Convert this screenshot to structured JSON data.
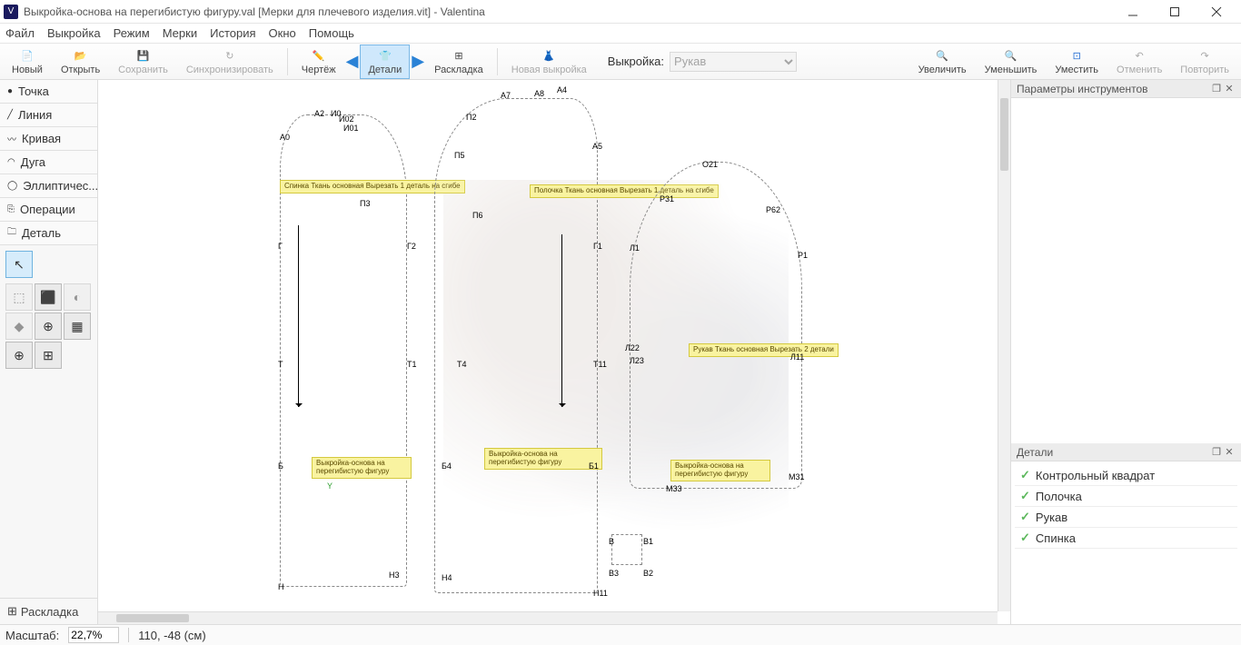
{
  "title": "Выкройка-основа на перегибистую фигуру.val [Мерки для плечевого изделия.vit] - Valentina",
  "menu": {
    "file": "Файл",
    "pattern": "Выкройка",
    "mode": "Режим",
    "measures": "Мерки",
    "history": "История",
    "window": "Окно",
    "help": "Помощь"
  },
  "toolbar": {
    "new": "Новый",
    "open": "Открыть",
    "save": "Сохранить",
    "sync": "Синхронизировать",
    "drawing": "Чертёж",
    "details": "Детали",
    "layout": "Раскладка",
    "newpattern": "Новая выкройка",
    "pattern_label": "Выкройка:",
    "pattern_value": "Рукав",
    "zoomin": "Увеличить",
    "zoomout": "Уменьшить",
    "fit": "Уместить",
    "undo": "Отменить",
    "redo": "Повторить"
  },
  "tool_cats": {
    "point": "Точка",
    "line": "Линия",
    "curve": "Кривая",
    "arc": "Дуга",
    "ellipse": "Эллиптичес...",
    "ops": "Операции",
    "detail": "Деталь"
  },
  "layout_link": "Раскладка",
  "docks": {
    "props": "Параметры инструментов",
    "details": "Детали"
  },
  "details_list": [
    "Контрольный квадрат",
    "Полочка",
    "Рукав",
    "Спинка"
  ],
  "status": {
    "scale_label": "Масштаб:",
    "scale_value": "22,7%",
    "coords": "110, -48  (см)"
  },
  "canvas": {
    "labels": {
      "spinka": "Спинка\nТкань основная\nВырезать 1 деталь на сгибе",
      "polochka": "Полочка\nТкань основная\nВырезать 1 деталь на сгибе",
      "rukav": "Рукав\nТкань основная\nВырезать 2 детали",
      "desc1": "Выкройка-основа на перегибистую фигуру",
      "desc2": "Выкройка-основа на перегибистую фигуру",
      "desc3": "Выкройка-основа на перегибистую фигуру"
    },
    "points": [
      "А0",
      "А2",
      "И0",
      "И02",
      "И01",
      "А7",
      "А8",
      "А4",
      "П2",
      "А5",
      "П5",
      "П6",
      "П3",
      "Г",
      "Г2",
      "Г1",
      "Б",
      "Б4",
      "Б1",
      "Н",
      "Н3",
      "Н4",
      "Н11",
      "Т4",
      "Т11",
      "Л22",
      "Л23",
      "О21",
      "Р31",
      "Р62",
      "Л1",
      "Р1",
      "Л11",
      "М31",
      "М33",
      "В",
      "В1",
      "В3",
      "В2",
      "Т",
      "Т1"
    ]
  }
}
